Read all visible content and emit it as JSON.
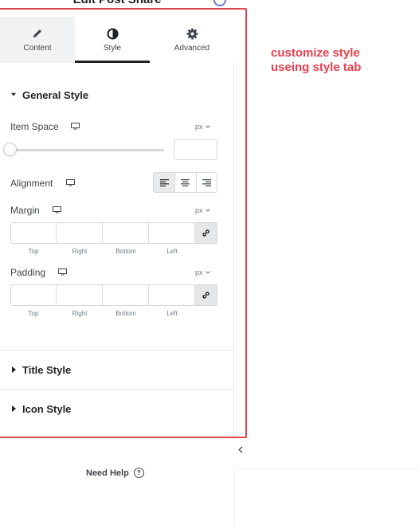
{
  "header": {
    "title": "Edit Post Share"
  },
  "tabs": [
    {
      "label": "Content",
      "icon": "pencil-icon"
    },
    {
      "label": "Style",
      "icon": "contrast-icon",
      "active": true
    },
    {
      "label": "Advanced",
      "icon": "gear-icon"
    }
  ],
  "general_style": {
    "title": "General Style",
    "expanded": true,
    "item_space": {
      "label": "Item Space",
      "unit": "px",
      "value": "",
      "slider_fraction": 0
    },
    "alignment": {
      "label": "Alignment",
      "options": [
        "left",
        "center",
        "right"
      ],
      "selected": "left"
    },
    "margin": {
      "label": "Margin",
      "unit": "px",
      "fields": [
        "Top",
        "Right",
        "Bottom",
        "Left"
      ]
    },
    "padding": {
      "label": "Padding",
      "unit": "px",
      "fields": [
        "Top",
        "Right",
        "Bottom",
        "Left"
      ]
    }
  },
  "sections": [
    {
      "title": "Title Style",
      "expanded": false
    },
    {
      "title": "Icon Style",
      "expanded": false
    }
  ],
  "annotation": {
    "text": "customize style useing style tab",
    "color": "#e8404c"
  },
  "footer": {
    "help_label": "Need Help",
    "help_icon_glyph": "?"
  },
  "colors": {
    "highlight": "#e2444f",
    "active_tab_underline": "#1f2124"
  }
}
